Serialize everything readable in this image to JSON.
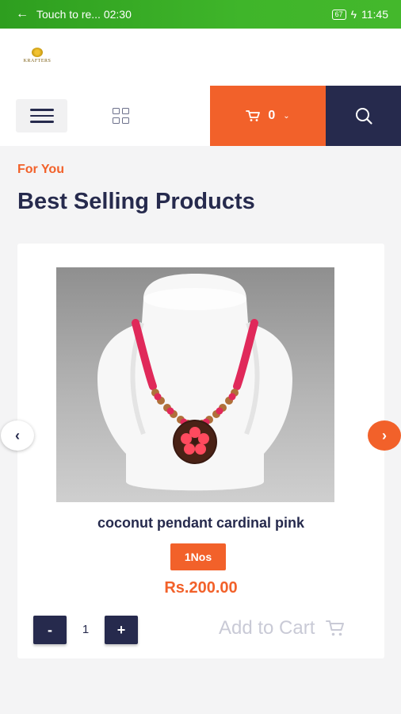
{
  "status_bar": {
    "back_glyph": "←",
    "notification_text": "Touch to re... 02:30",
    "battery_level": "67",
    "time": "11:45"
  },
  "brand": {
    "logo_text": "KRAFTERS"
  },
  "nav": {
    "cart_count": "0"
  },
  "section": {
    "kicker": "For You",
    "title": "Best Selling Products"
  },
  "product": {
    "name": "coconut pendant cardinal pink",
    "unit": "1Nos",
    "price": "Rs.200.00",
    "quantity": "1",
    "minus_label": "-",
    "plus_label": "+",
    "add_to_cart_label": "Add to Cart"
  },
  "carousel": {
    "prev_glyph": "‹",
    "next_glyph": "›"
  },
  "colors": {
    "accent": "#f2612a",
    "navy": "#262a4d",
    "status_green": "#3fb52a"
  }
}
